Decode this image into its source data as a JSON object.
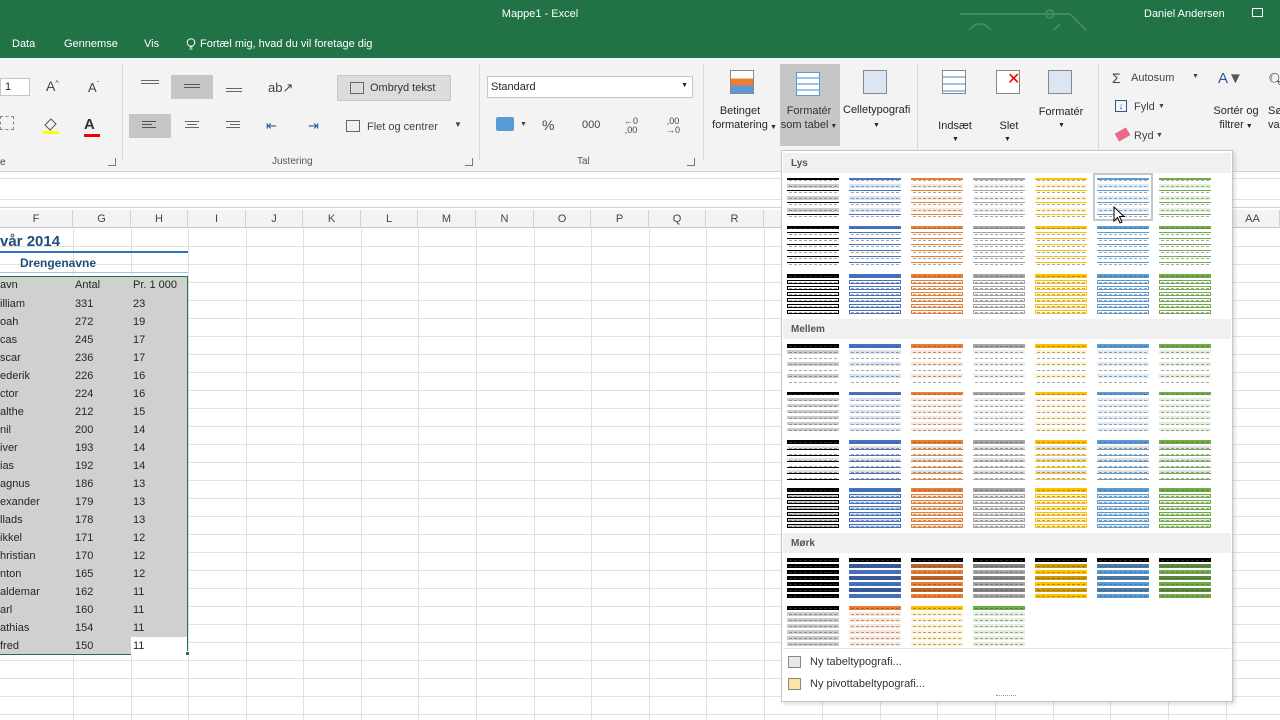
{
  "window": {
    "title": "Mappe1  -  Excel",
    "user": "Daniel Andersen"
  },
  "tabs": [
    "Data",
    "Gennemse",
    "Vis"
  ],
  "tell_me": "Fortæl mig, hvad du vil foretage dig",
  "ribbon": {
    "font_size": "1",
    "wrap_text": "Ombryd tekst",
    "merge_center": "Flet og centrer",
    "alignment_group": "Justering",
    "number_format": "Standard",
    "percent": "%",
    "thousands": "000",
    "number_group": "Tal",
    "conditional_formatting": [
      "Betinget",
      "formatering"
    ],
    "format_as_table": [
      "Formatér",
      "som tabel"
    ],
    "cell_styles": "Celletypografi",
    "insert": "Indsæt",
    "delete": "Slet",
    "format": "Formatér",
    "autosum": "Autosum",
    "fill": "Fyld",
    "clear": "Ryd",
    "sort_filter": [
      "Sortér og",
      "filtrer"
    ],
    "find_select": [
      "Sø",
      "va"
    ]
  },
  "columns": [
    "F",
    "G",
    "H",
    "I",
    "J",
    "K",
    "L",
    "M",
    "N",
    "O",
    "P",
    "Q",
    "R",
    "AA"
  ],
  "sheet": {
    "title": "vår 2014",
    "subtitle": "Drengenavne",
    "headers": [
      "avn",
      "Antal",
      "Pr. 1 000"
    ],
    "rows": [
      [
        "illiam",
        "331",
        "23"
      ],
      [
        "oah",
        "272",
        "19"
      ],
      [
        "cas",
        "245",
        "17"
      ],
      [
        "scar",
        "236",
        "17"
      ],
      [
        "ederik",
        "226",
        "16"
      ],
      [
        "ctor",
        "224",
        "16"
      ],
      [
        "althe",
        "212",
        "15"
      ],
      [
        "nil",
        "200",
        "14"
      ],
      [
        "iver",
        "193",
        "14"
      ],
      [
        "ias",
        "192",
        "14"
      ],
      [
        "agnus",
        "186",
        "13"
      ],
      [
        "exander",
        "179",
        "13"
      ],
      [
        "llads",
        "178",
        "13"
      ],
      [
        "ikkel",
        "171",
        "12"
      ],
      [
        "hristian",
        "170",
        "12"
      ],
      [
        "nton",
        "165",
        "12"
      ],
      [
        "aldemar",
        "162",
        "11"
      ],
      [
        "arl",
        "160",
        "11"
      ],
      [
        "athias",
        "154",
        "11"
      ],
      [
        "fred",
        "150",
        "11"
      ]
    ]
  },
  "gallery": {
    "sections": [
      "Lys",
      "Mellem",
      "Mørk"
    ],
    "accent_colors": {
      "black": "#000000",
      "blue": "#4472c4",
      "orange": "#ed7d31",
      "gray": "#a5a5a5",
      "gold": "#ffc000",
      "lightblue": "#5b9bd5",
      "green": "#70ad47"
    },
    "new_table_style": "Ny tabeltypografi...",
    "new_pivot_style": "Ny pivottabeltypografi..."
  }
}
